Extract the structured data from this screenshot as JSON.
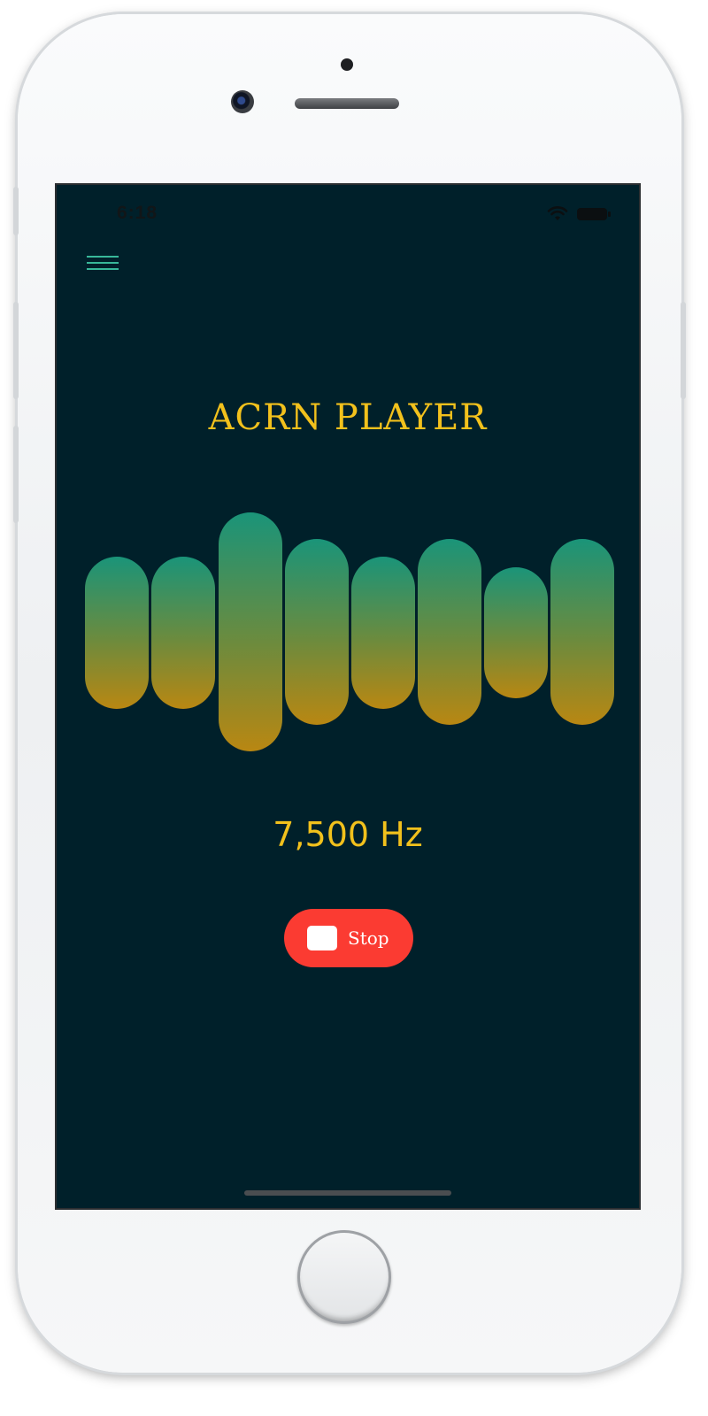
{
  "status_bar": {
    "time": "6:18",
    "wifi_icon": "wifi-icon",
    "battery_icon": "battery-icon"
  },
  "toolbar": {
    "menu_icon": "hamburger-menu-icon"
  },
  "player": {
    "title": "ACRN PLAYER",
    "frequency": "7,500 Hz",
    "stop_label": "Stop",
    "stop_icon": "stop-square-icon"
  },
  "visualizer": {
    "bar_count": 8,
    "colors": {
      "top": "#1a9479",
      "bottom": "#b98712"
    }
  },
  "colors": {
    "background": "#00202a",
    "accent": "#f2c11c",
    "menu_icon": "#38b89a",
    "stop_button": "#fb3b32"
  }
}
